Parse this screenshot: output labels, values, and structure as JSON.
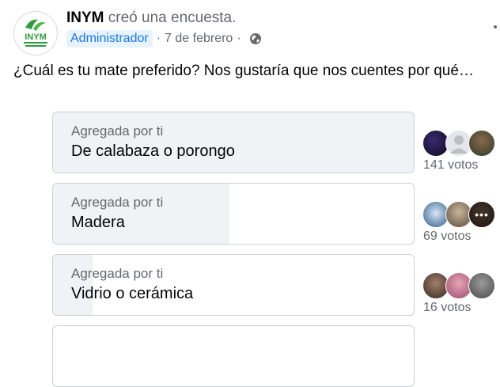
{
  "post": {
    "author_name": "INYM",
    "action": "creó una encuesta.",
    "role_badge": "Administrador",
    "date": "7 de febrero",
    "separator": "·",
    "privacy_icon": "globe-icon",
    "menu_icon": "more-options-icon",
    "question": "¿Cuál es tu mate preferido? Nos gustaría que nos cuentes por qué…"
  },
  "logo": {
    "text": "INYM"
  },
  "poll": {
    "options": [
      {
        "added_by": "Agregada por ti",
        "label": "De calabaza o porongo",
        "votes": "141 votos",
        "share": 1.0,
        "more_icon": ""
      },
      {
        "added_by": "Agregada por ti",
        "label": "Madera",
        "votes": "69 votos",
        "share": 0.49,
        "more_icon": "•••"
      },
      {
        "added_by": "Agregada por ti",
        "label": "Vidrio o cerámica",
        "votes": "16 votos",
        "share": 0.11,
        "more_icon": ""
      }
    ]
  },
  "colors": {
    "accent": "#1877f2",
    "badge_bg": "#e7f3ff",
    "bar_fill": "#f0f2f5",
    "secondary_text": "#65676b",
    "logo_green": "#2e9e3a"
  }
}
